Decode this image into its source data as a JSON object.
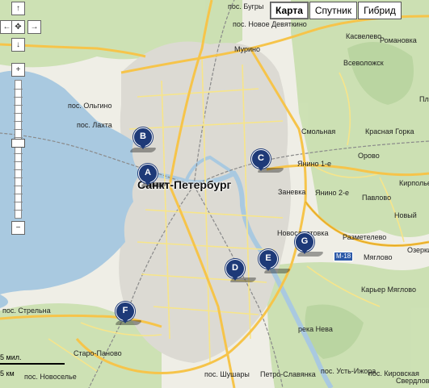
{
  "map_type": {
    "items": [
      "Карта",
      "Спутник",
      "Гибрид"
    ],
    "active": "Карта"
  },
  "nav": {
    "up": "↑",
    "down": "↓",
    "left": "←",
    "right": "→",
    "center": "✥",
    "zoom_in": "+",
    "zoom_out": "−",
    "zoom_level_fraction": 0.45
  },
  "scale": {
    "label": "5 мил.",
    "label2": "5 км"
  },
  "city": "Санкт-Петербург",
  "markers": [
    "A",
    "B",
    "C",
    "D",
    "E",
    "F",
    "G"
  ],
  "highway": "M-18",
  "places": [
    "пос. Бугры",
    "пос. Новое Девяткино",
    "Мурино",
    "Касвелево",
    "Романовка",
    "Всеволожск",
    "пос. Ольгино",
    "пос. Лахта",
    "Смольная",
    "Красная Горка",
    "Орово",
    "Янино 1-е",
    "Янино 2-е",
    "Заневка",
    "Павлово",
    "Кирполье",
    "Новый",
    "Разметелево",
    "Новосаратовка",
    "Мяглово",
    "Озерки",
    "Карьер Мяглово",
    "пос. Стрельна",
    "Старо-Паново",
    "пос. Новоселье",
    "пос. Шушары",
    "Петро-Славянка",
    "пос. Усть-Ижора",
    "река Нева",
    "Свердлова",
    "Плин",
    "пос. Кировская"
  ],
  "colors": {
    "water": "#a9c9e0",
    "land": "#efeee6",
    "green": "#c9dfae",
    "urban": "#dcdad3",
    "road_major": "#f6c44a",
    "road_minor": "#f7e58a",
    "rail": "#8a8a8a",
    "marker": "#1e3a78"
  }
}
